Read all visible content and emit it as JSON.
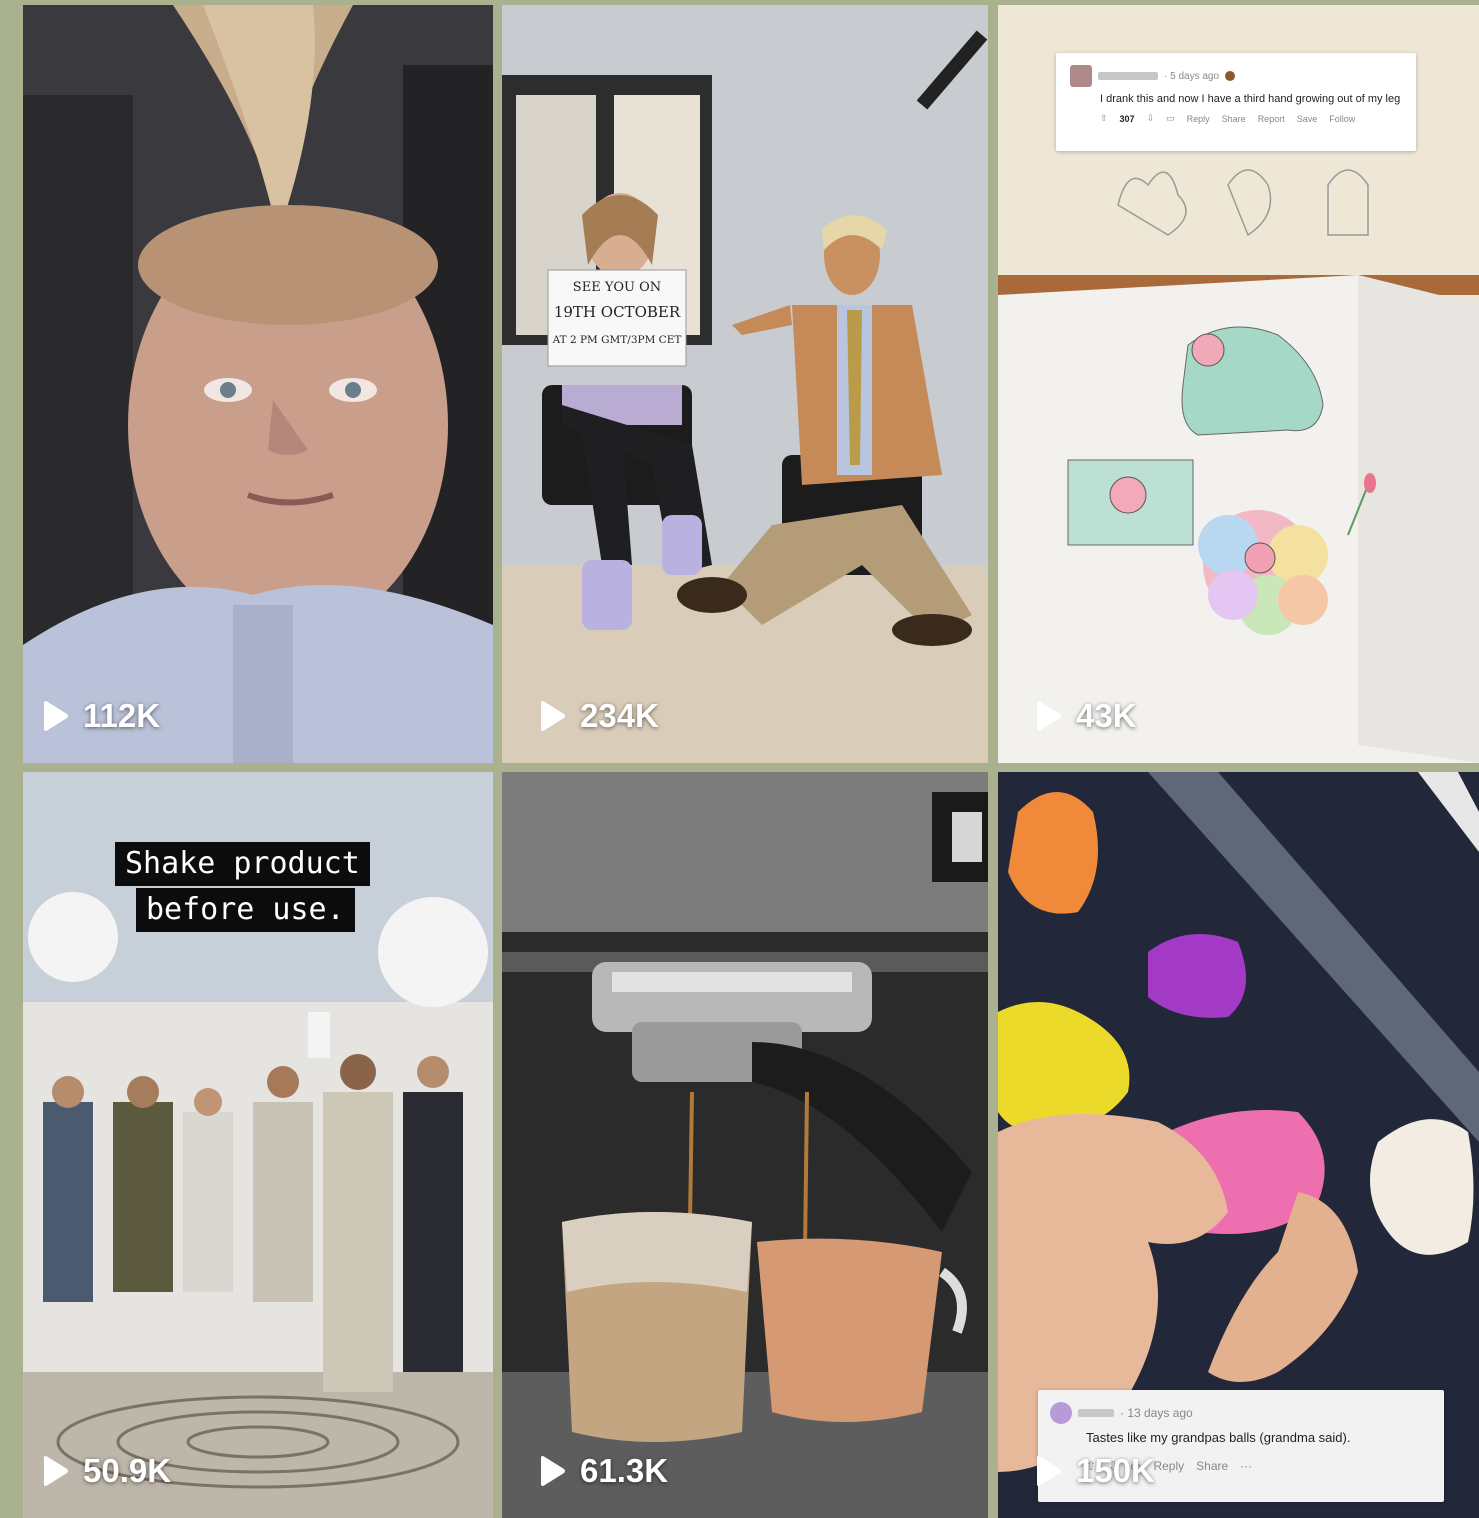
{
  "tiles": [
    {
      "views": "112K"
    },
    {
      "views": "234K",
      "sign": {
        "line1": "SEE YOU ON",
        "line2": "19TH OCTOBER",
        "line3": "AT 2 PM GMT/3PM CET"
      }
    },
    {
      "views": "43K",
      "comment": {
        "time": "· 5 days ago",
        "text": "I drank this and now I have a third hand growing out of my leg",
        "votes": "307",
        "reply": "Reply",
        "share": "Share",
        "report": "Report",
        "save": "Save",
        "follow": "Follow"
      }
    },
    {
      "views": "50.9K",
      "caption": {
        "line1": "Shake product",
        "line2": "before use."
      }
    },
    {
      "views": "61.3K"
    },
    {
      "views": "150K",
      "comment": {
        "time": "· 13 days ago",
        "text": "Tastes like my grandpas balls (grandma said).",
        "reply": "Reply",
        "share": "Share",
        "more": "···"
      }
    }
  ],
  "colors": {
    "background": "#a9b18f",
    "play": "#ffffff"
  },
  "icons": [
    "play-icon",
    "upvote-icon",
    "downvote-icon",
    "comment-icon",
    "avatar"
  ]
}
